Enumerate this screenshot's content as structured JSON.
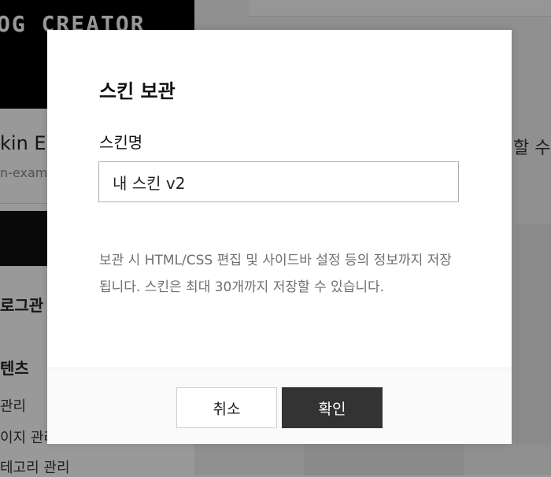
{
  "background": {
    "banner_text": "OG CREATOR",
    "skin_title": "kin E",
    "skin_subtitle": "n-exam",
    "menu_program": "로그관",
    "menu_contents": "텐츠",
    "items": [
      "관리",
      "이지 관리",
      "테고리 관리"
    ],
    "right_text": "할 수"
  },
  "modal": {
    "title": "스킨 보관",
    "field_label": "스킨명",
    "input_value": "내 스킨 v2",
    "notice": "보관 시 HTML/CSS 편집 및 사이드바 설정 등의 정보까지 저장됩니다. 스킨은 최대 30개까지 저장할 수 있습니다.",
    "cancel_label": "취소",
    "confirm_label": "확인"
  }
}
